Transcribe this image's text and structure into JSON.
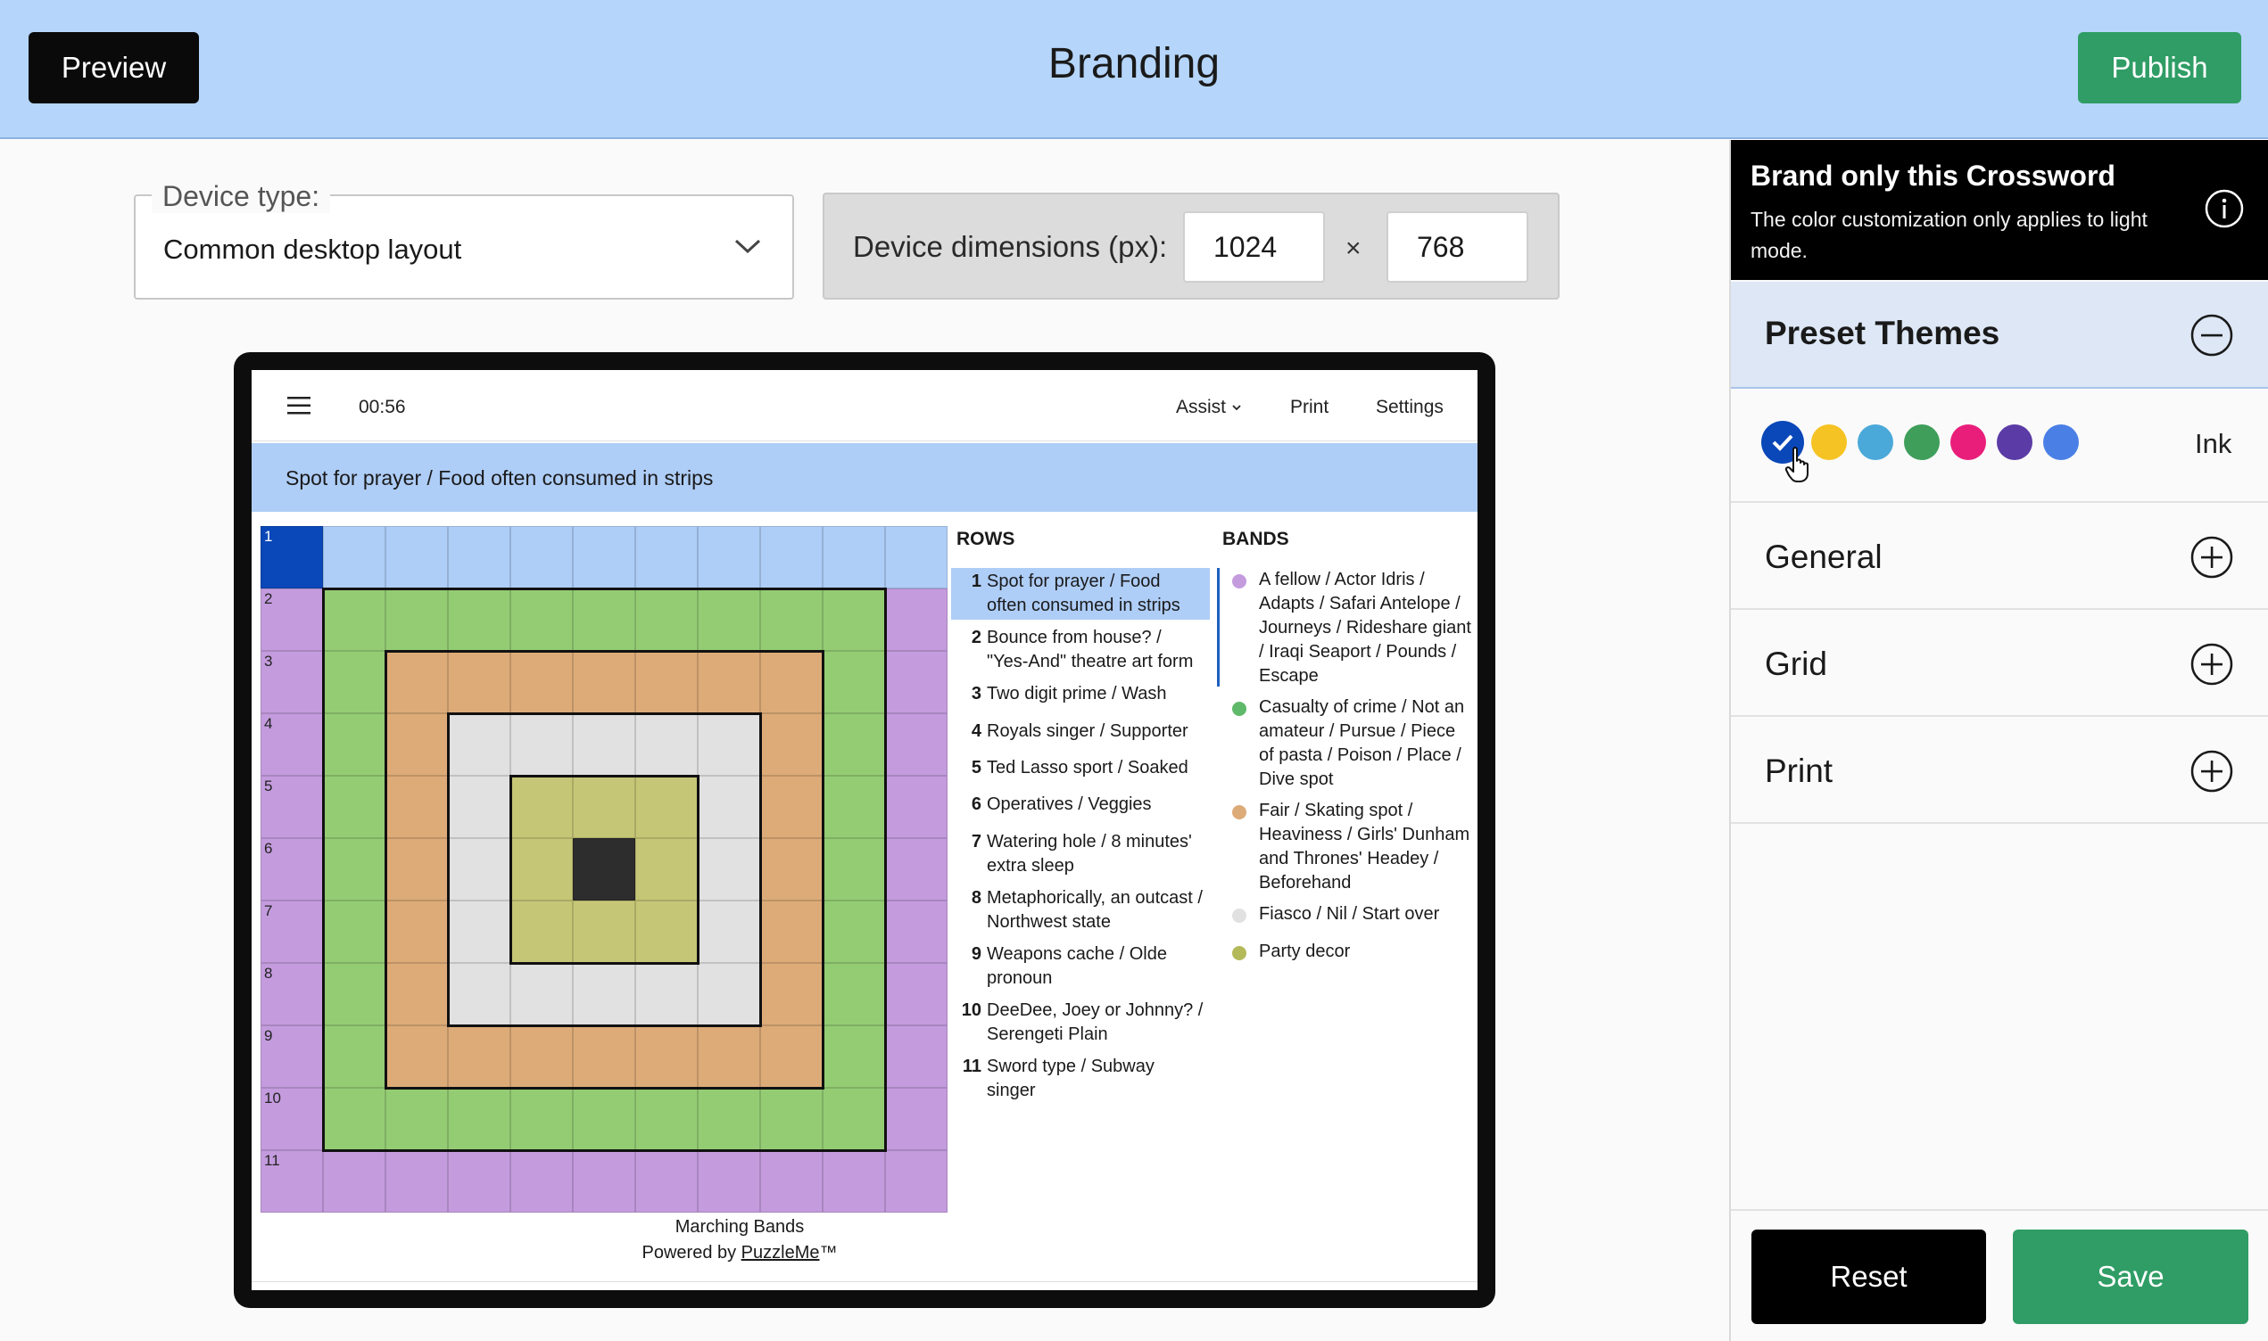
{
  "header": {
    "preview_label": "Preview",
    "title": "Branding",
    "publish_label": "Publish"
  },
  "device": {
    "type_label": "Device type:",
    "type_value": "Common desktop layout",
    "dims_label": "Device dimensions (px):",
    "width": "1024",
    "height": "768",
    "times_symbol": "×"
  },
  "crossword": {
    "timer": "00:56",
    "menu": {
      "assist": "Assist",
      "print": "Print",
      "settings": "Settings"
    },
    "active_clue": "Spot for prayer / Food often consumed in strips",
    "grid": {
      "size": 11,
      "row_numbers": [
        "1",
        "2",
        "3",
        "4",
        "5",
        "6",
        "7",
        "8",
        "9",
        "10",
        "11"
      ],
      "band_colors": [
        "#c49cde",
        "#94cc74",
        "#ddab78",
        "#e1e1e1",
        "#c6c677"
      ],
      "active_row_color": "#aecdf7",
      "selected_color": "#0a47b8",
      "center_color": "#2d2d2d"
    },
    "rows_heading": "ROWS",
    "bands_heading": "BANDS",
    "rows": [
      {
        "num": "1",
        "text": "Spot for prayer / Food often consumed in strips",
        "active": true
      },
      {
        "num": "2",
        "text": "Bounce from house? / \"Yes-And\" theatre art form"
      },
      {
        "num": "3",
        "text": "Two digit prime / Wash"
      },
      {
        "num": "4",
        "text": "Royals singer / Supporter"
      },
      {
        "num": "5",
        "text": "Ted Lasso sport / Soaked"
      },
      {
        "num": "6",
        "text": "Operatives / Veggies"
      },
      {
        "num": "7",
        "text": "Watering hole / 8 minutes' extra sleep"
      },
      {
        "num": "8",
        "text": "Metaphorically, an outcast / Northwest state"
      },
      {
        "num": "9",
        "text": "Weapons cache / Olde pronoun"
      },
      {
        "num": "10",
        "text": "DeeDee, Joey or Johnny? / Serengeti Plain"
      },
      {
        "num": "11",
        "text": "Sword type / Subway singer"
      }
    ],
    "bands": [
      {
        "color": "#c49cde",
        "text": "A fellow / Actor Idris / Adapts / Safari Antelope / Journeys / Rideshare giant / Iraqi Seaport / Pounds / Escape"
      },
      {
        "color": "#5fb96a",
        "text": "Casualty of crime / Not an amateur / Pursue / Piece of pasta / Poison / Place / Dive spot"
      },
      {
        "color": "#ddab78",
        "text": "Fair / Skating spot / Heaviness / Girls' Dunham and Thrones' Headey / Beforehand"
      },
      {
        "color": "#e1e1e1",
        "text": "Fiasco / Nil / Start over"
      },
      {
        "color": "#b4b95a",
        "text": "Party decor"
      }
    ],
    "footer_title": "Marching Bands",
    "footer_powered": "Powered by ",
    "footer_brand": "PuzzleMe",
    "footer_tm": "™"
  },
  "panel": {
    "brand_title": "Brand only this Crossword",
    "brand_desc": "The color customization only applies to light mode.",
    "preset_title": "Preset Themes",
    "swatches": [
      "#0a47b8",
      "#f6c324",
      "#4aa9d9",
      "#3e9e5a",
      "#e91e7a",
      "#5b3ba6",
      "#4a7fe6"
    ],
    "ink_label": "Ink",
    "sections": [
      "General",
      "Grid",
      "Print"
    ],
    "reset_label": "Reset",
    "save_label": "Save"
  }
}
